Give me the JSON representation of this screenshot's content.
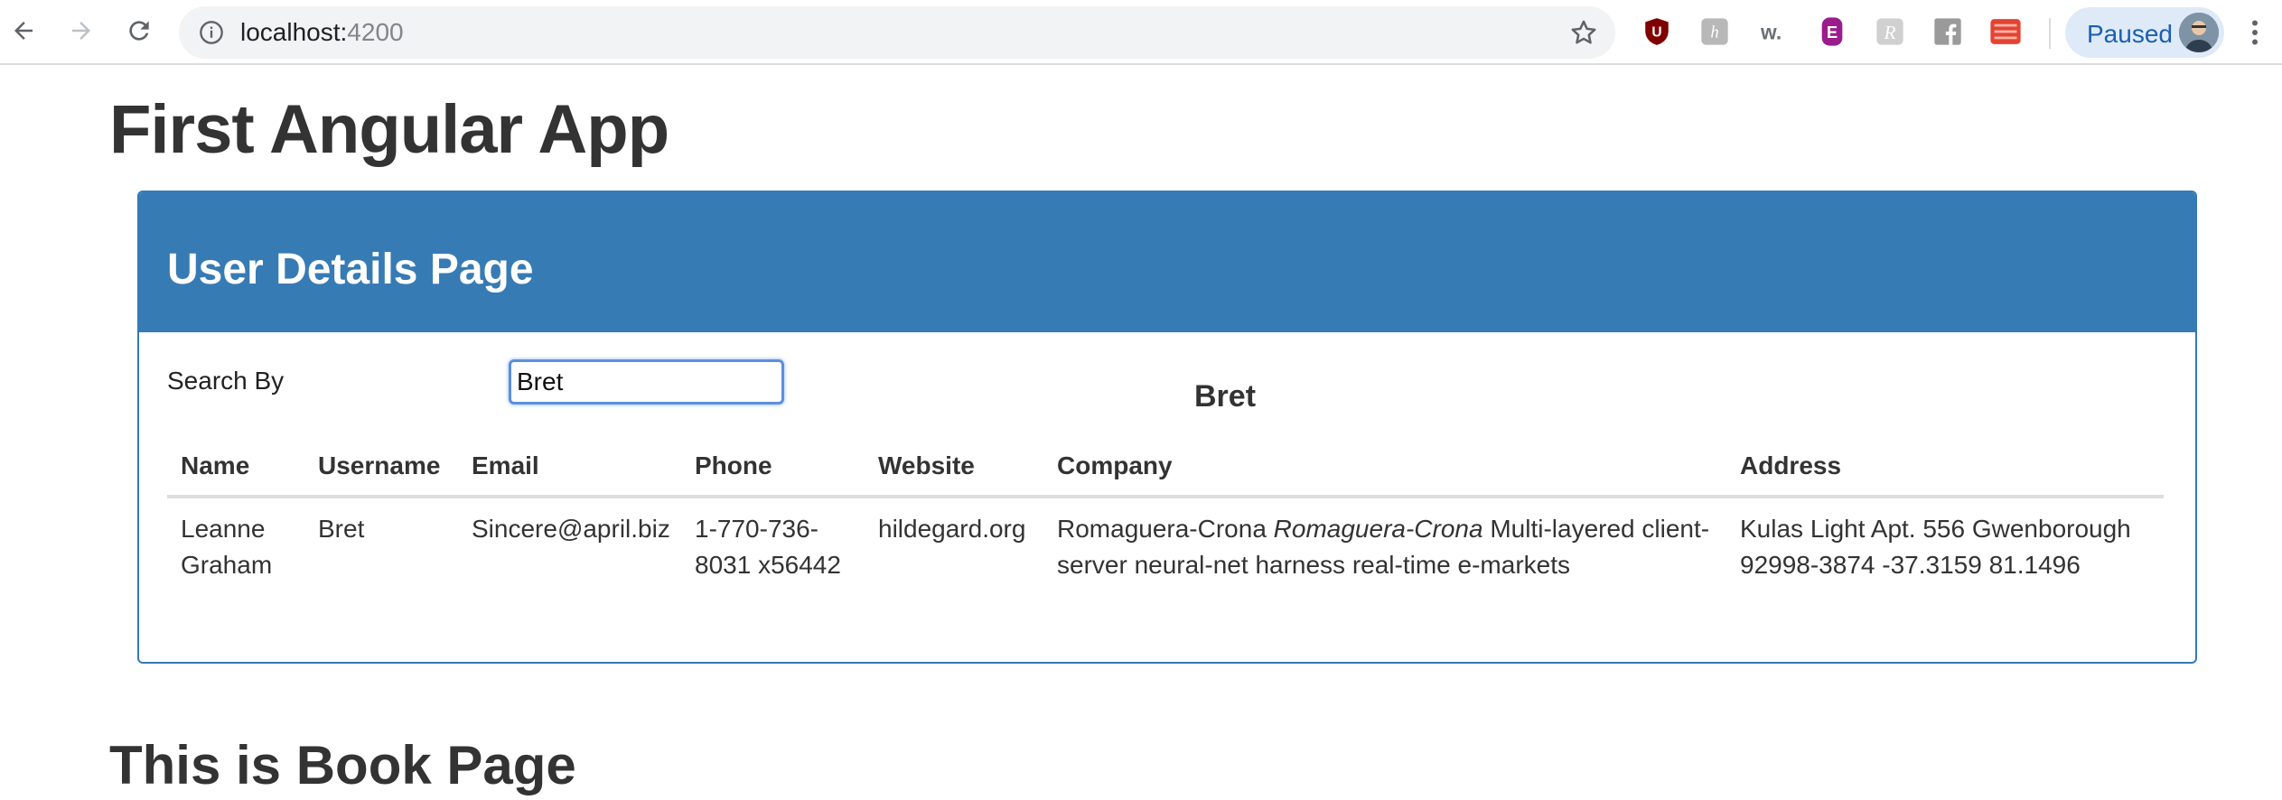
{
  "browser": {
    "url_host": "localhost:",
    "url_port": "4200",
    "profile_label": "Paused",
    "extensions": [
      "ublock-icon",
      "honey-icon",
      "wappalyzer-icon",
      "ext-e-icon",
      "ext-r-icon",
      "facebook-icon",
      "todoist-icon"
    ]
  },
  "page": {
    "title": "First Angular App",
    "panel_title": "User Details Page",
    "search_label": "Search By",
    "search_value": "Bret",
    "search_echo": "Bret",
    "book_heading": "This is Book Page"
  },
  "table": {
    "headers": [
      "Name",
      "Username",
      "Email",
      "Phone",
      "Website",
      "Company",
      "Address"
    ],
    "rows": [
      {
        "name": "Leanne Graham",
        "username": "Bret",
        "email": "Sincere@april.biz",
        "phone": "1-770-736-8031 x56442",
        "website": "hildegard.org",
        "company_name": "Romaguera-Crona",
        "company_name_italic": "Romaguera-Crona",
        "company_phrase": "Multi-layered client-server neural-net",
        "company_bs": "harness real-time e-markets",
        "address": "Kulas Light Apt. 556 Gwenborough 92998-3874 -37.3159 81.1496"
      }
    ]
  },
  "colors": {
    "panel_blue": "#377bb5",
    "focus_ring": "#5b8fe0"
  }
}
